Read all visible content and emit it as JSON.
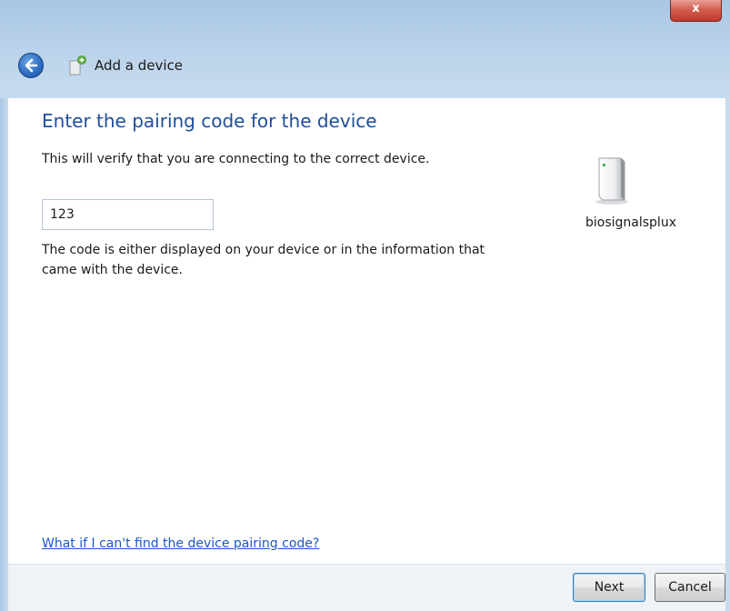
{
  "window": {
    "title": "Add a device",
    "close_label": "x"
  },
  "main": {
    "heading": "Enter the pairing code for the device",
    "subtext": "This will verify that you are connecting to the correct device.",
    "code_input_value": "123",
    "help_text": "The code is either displayed on your device or in the information that came with the device.",
    "device_name": "biosignalsplux",
    "help_link": "What if I can't find the device pairing code?"
  },
  "footer": {
    "next_label": "Next",
    "cancel_label": "Cancel"
  },
  "icons": {
    "back": "back-arrow-icon",
    "wizard": "add-device-icon",
    "device": "device-tower-icon",
    "close": "close-icon"
  },
  "colors": {
    "heading": "#1e4e9c",
    "link": "#1c55c9",
    "close_button": "#c13a2a",
    "chrome": "#b9d2ea"
  }
}
